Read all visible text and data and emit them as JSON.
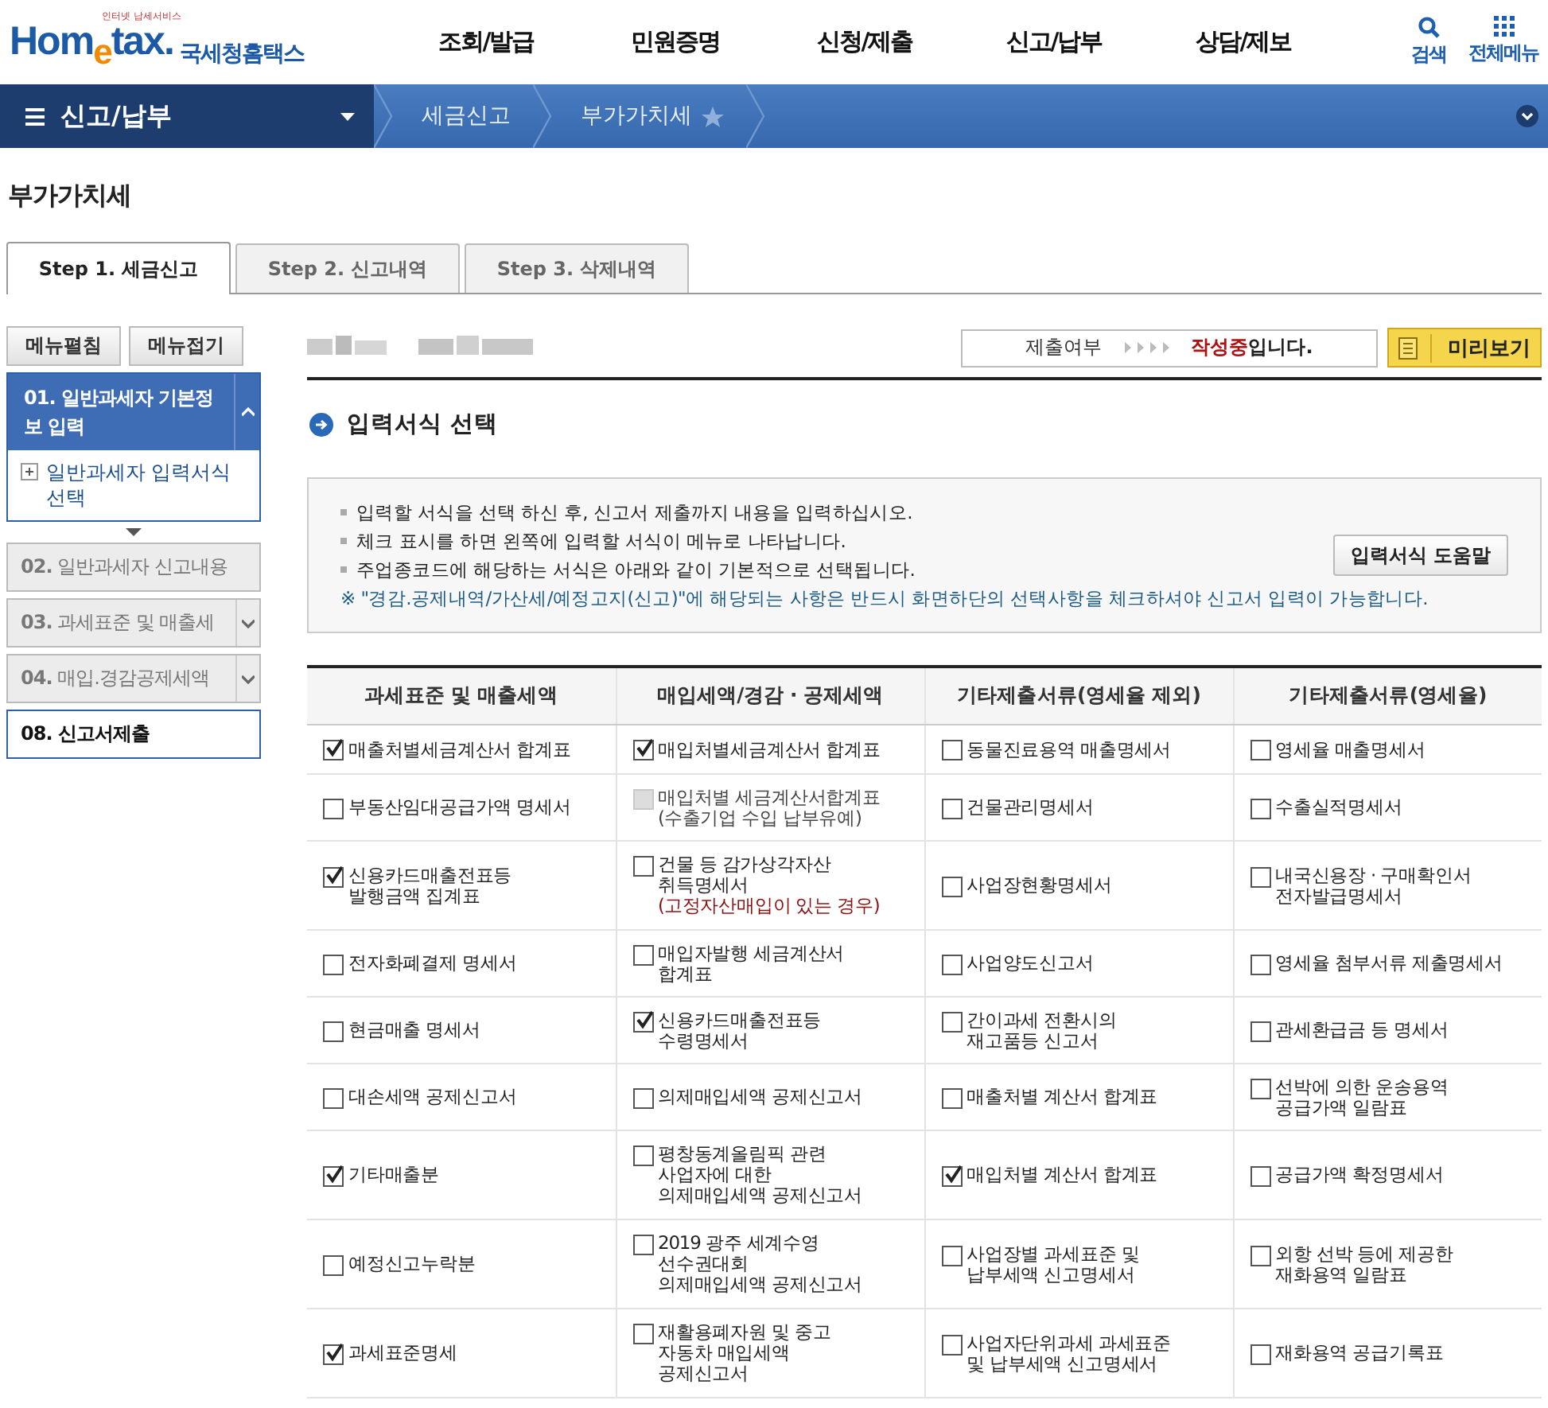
{
  "header": {
    "logo": "Hom$_{e}$tax.",
    "logo_tagline": "인터넷 납세서비스",
    "site_name": "국세청홈택스",
    "menu": [
      "조회/발급",
      "민원증명",
      "신청/제출",
      "신고/납부",
      "상담/제보"
    ],
    "tools": [
      {
        "kind": "search",
        "label": "검색"
      },
      {
        "kind": "grid",
        "label": "전체메뉴"
      }
    ]
  },
  "breadcrumb": {
    "menu": "신고/납부",
    "items": [
      "세금신고",
      "부가가치세"
    ]
  },
  "page_title": "부가가치세",
  "tabs": [
    {
      "label": "Step 1. 세금신고",
      "selected": true
    },
    {
      "label": "Step 2. 신고내역",
      "selected": false
    },
    {
      "label": "Step 3. 삭제내역",
      "selected": false
    }
  ],
  "sidebar": {
    "buttons": [
      "메뉴펼침",
      "메뉴접기"
    ],
    "steps": [
      {
        "label": "01. 일반과세자 기본정보 입력",
        "kind": "active",
        "children": [
          {
            "label": "일반과세자 입력서식 선택"
          }
        ]
      },
      {
        "label": "**02.** 일반과세자 신고내용",
        "kind": "disabled"
      },
      {
        "label": "**03.** 과세표준 및 매출세",
        "kind": "collapsed"
      },
      {
        "label": "**04.** 매입.경감공제세액",
        "kind": "collapsed"
      },
      {
        "label": "08. 신고서제출",
        "kind": "current"
      }
    ]
  },
  "status": {
    "label": "제출여부",
    "value": "작성중",
    "suffix": "입니다."
  },
  "preview_button": "미리보기",
  "section_title": "입력서식 선택",
  "notice": {
    "lines": [
      "입력할 서식을 선택 하신 후, 신고서 제출까지 내용을 입력하십시오.",
      "체크 표시를 하면 왼쪽에 입력할 서식이 메뉴로 나타납니다.",
      "주업종코드에 해당하는 서식은 아래와 같이 기본적으로 선택됩니다."
    ],
    "note": "※ \"경감.공제내역/가산세/예정고지(신고)\"에 해당되는 사항은 반드시 화면하단의 선택사항을 체크하셔야 신고서 입력이 가능합니다.",
    "help_button": "입력서식 도움말"
  },
  "table": {
    "columns": [
      "과세표준 및 매출세액",
      "매입세액/경감 · 공제세액",
      "기타제출서류(영세율 제외)",
      "기타제출서류(영세율)"
    ],
    "rows": [
      [
        {
          "label": "매출처별세금계산서 합계표",
          "checked": true,
          "disabled": false
        },
        {
          "label": "매입처별세금계산서 합계표",
          "checked": true,
          "disabled": false
        },
        {
          "label": "동물진료용역 매출명세서",
          "checked": false,
          "disabled": false
        },
        {
          "label": "영세율 매출명세서",
          "checked": false,
          "disabled": false
        }
      ],
      [
        {
          "label": "부동산임대공급가액 명세서",
          "checked": false,
          "disabled": false
        },
        {
          "label": "매입처별 세금계산서합계표\n(수출기업 수입 납부유예)",
          "checked": false,
          "disabled": true
        },
        {
          "label": "건물관리명세서",
          "checked": false,
          "disabled": false
        },
        {
          "label": "수출실적명세서",
          "checked": false,
          "disabled": false
        }
      ],
      [
        {
          "label": "신용카드매출전표등\n발행금액 집계표",
          "checked": true,
          "disabled": false
        },
        {
          "label": "건물 등 감가상각자산\n취득명세서",
          "note": "(고정자산매입이 있는 경우)",
          "checked": false,
          "disabled": false
        },
        {
          "label": "사업장현황명세서",
          "checked": false,
          "disabled": false
        },
        {
          "label": "내국신용장 · 구매확인서\n전자발급명세서",
          "checked": false,
          "disabled": false
        }
      ],
      [
        {
          "label": "전자화폐결제 명세서",
          "checked": false,
          "disabled": false
        },
        {
          "label": "매입자발행 세금계산서\n합계표",
          "checked": false,
          "disabled": false
        },
        {
          "label": "사업양도신고서",
          "checked": false,
          "disabled": false
        },
        {
          "label": "영세율 첨부서류 제출명세서",
          "checked": false,
          "disabled": false
        }
      ],
      [
        {
          "label": "현금매출 명세서",
          "checked": false,
          "disabled": false
        },
        {
          "label": "신용카드매출전표등\n수령명세서",
          "checked": true,
          "disabled": false
        },
        {
          "label": "간이과세 전환시의\n재고품등 신고서",
          "checked": false,
          "disabled": false
        },
        {
          "label": "관세환급금 등 명세서",
          "checked": false,
          "disabled": false
        }
      ],
      [
        {
          "label": "대손세액 공제신고서",
          "checked": false,
          "disabled": false
        },
        {
          "label": "의제매입세액 공제신고서",
          "checked": false,
          "disabled": false
        },
        {
          "label": "매출처별 계산서 합계표",
          "checked": false,
          "disabled": false
        },
        {
          "label": "선박에 의한 운송용역\n공급가액 일람표",
          "checked": false,
          "disabled": false
        }
      ],
      [
        {
          "label": "기타매출분",
          "checked": true,
          "disabled": false
        },
        {
          "label": "평창동계올림픽 관련\n사업자에 대한\n의제매입세액 공제신고서",
          "checked": false,
          "disabled": false
        },
        {
          "label": "매입처별 계산서 합계표",
          "checked": true,
          "disabled": false
        },
        {
          "label": "공급가액 확정명세서",
          "checked": false,
          "disabled": false
        }
      ],
      [
        {
          "label": "예정신고누락분",
          "checked": false,
          "disabled": false
        },
        {
          "label": "2019 광주 세계수영\n선수권대회\n의제매입세액 공제신고서",
          "checked": false,
          "disabled": false
        },
        {
          "label": "사업장별 과세표준 및\n납부세액 신고명세서",
          "checked": false,
          "disabled": false
        },
        {
          "label": "외항 선박 등에 제공한\n재화용역 일람표",
          "checked": false,
          "disabled": false
        }
      ],
      [
        {
          "label": "과세표준명세",
          "checked": true,
          "disabled": false
        },
        {
          "label": "재활용폐자원 및 중고\n자동차 매입세액\n공제신고서",
          "checked": false,
          "disabled": false
        },
        {
          "label": "사업자단위과세 과세표준\n및 납부세액 신고명세서",
          "checked": false,
          "disabled": false
        },
        {
          "label": "재화용역 공급기록표",
          "checked": false,
          "disabled": false
        }
      ]
    ]
  }
}
